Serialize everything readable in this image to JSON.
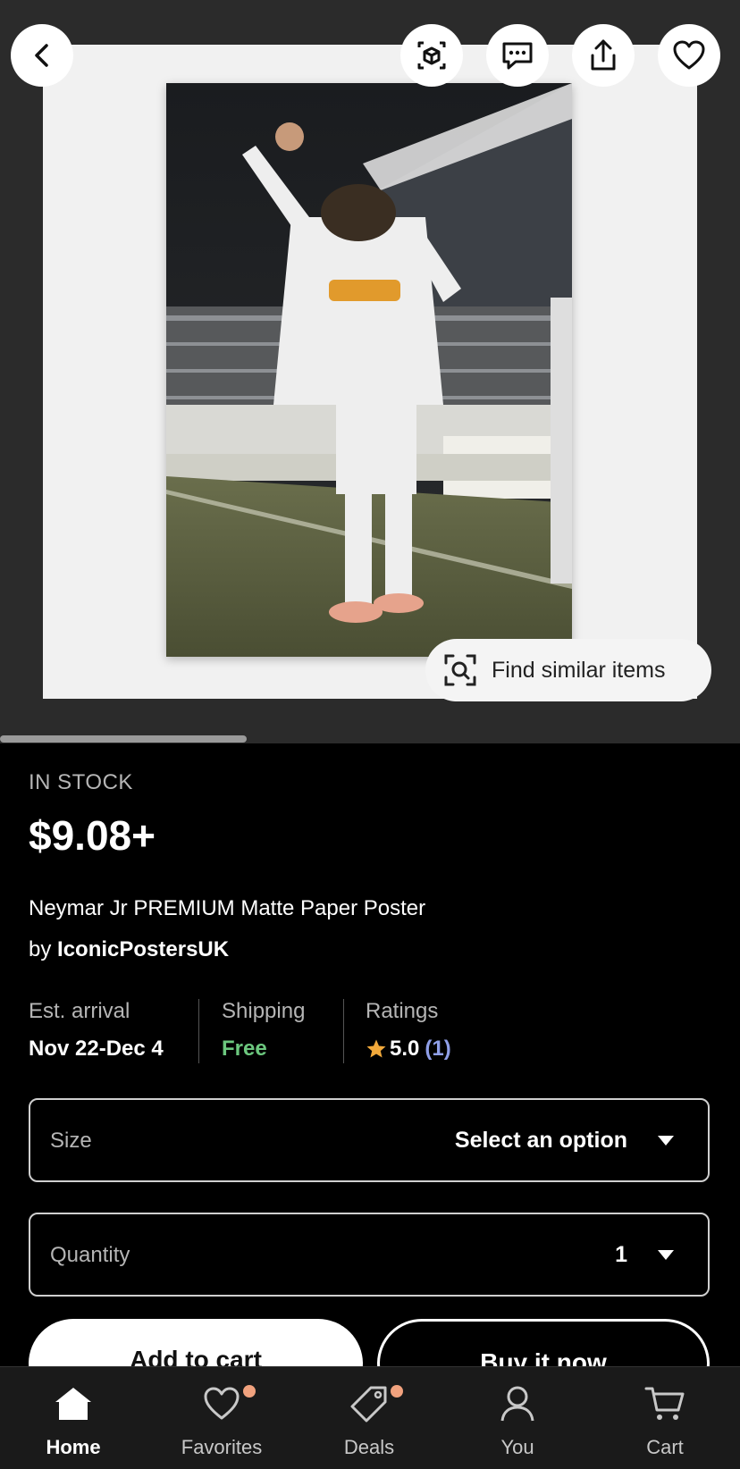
{
  "gallery": {
    "find_similar_label": "Find similar items"
  },
  "product": {
    "stock_status": "IN STOCK",
    "price": "$9.08+",
    "title": "Neymar Jr PREMIUM Matte Paper Poster",
    "seller_prefix": "by",
    "seller_name": "IconicPostersUK"
  },
  "details": {
    "arrival_label": "Est. arrival",
    "arrival_value": "Nov 22-Dec 4",
    "shipping_label": "Shipping",
    "shipping_value": "Free",
    "ratings_label": "Ratings",
    "rating_value": "5.0",
    "rating_count": "(1)"
  },
  "options": {
    "size_label": "Size",
    "size_value": "Select an option",
    "quantity_label": "Quantity",
    "quantity_value": "1"
  },
  "actions": {
    "add_to_cart": "Add to cart",
    "buy_now": "Buy it now"
  },
  "nav": [
    {
      "label": "Home",
      "icon": "home-icon"
    },
    {
      "label": "Favorites",
      "icon": "heart-icon"
    },
    {
      "label": "Deals",
      "icon": "tag-icon"
    },
    {
      "label": "You",
      "icon": "person-icon"
    },
    {
      "label": "Cart",
      "icon": "cart-icon"
    }
  ],
  "colors": {
    "shipping_free": "#6cc77e",
    "rating_count": "#8f9fe8",
    "star": "#f2a93b",
    "notification_dot": "#f1a27e"
  }
}
